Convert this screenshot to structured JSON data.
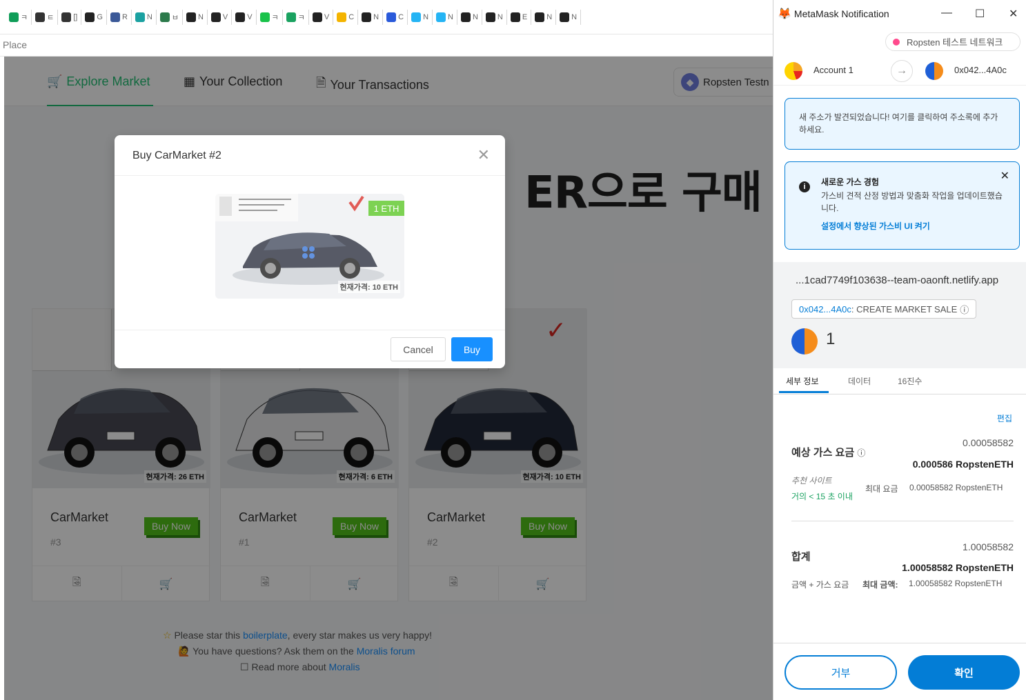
{
  "browser": {
    "tabs": [
      {
        "icon": "spreadsheet-icon",
        "label": "ㅋ",
        "color": "#0f9d58"
      },
      {
        "icon": "notion-icon",
        "label": "ㅌ",
        "color": "#333333"
      },
      {
        "icon": "notion-icon",
        "label": "[]",
        "color": "#333333"
      },
      {
        "icon": "github-icon",
        "label": "G",
        "color": "#222222"
      },
      {
        "icon": "flag-icon",
        "label": "R",
        "color": "#3b5998"
      },
      {
        "icon": "diamond-icon",
        "label": "N",
        "color": "#1ba1a1"
      },
      {
        "icon": "grid-icon",
        "label": "ㅂ",
        "color": "#2c7a4b"
      },
      {
        "icon": "github-icon",
        "label": "N",
        "color": "#222222"
      },
      {
        "icon": "github-icon",
        "label": "V",
        "color": "#222222"
      },
      {
        "icon": "github-icon",
        "label": "V",
        "color": "#222222"
      },
      {
        "icon": "n-icon",
        "label": "ㅋ",
        "color": "#19c24a"
      },
      {
        "icon": "chat-icon",
        "label": "ㅋ",
        "color": "#1aa260"
      },
      {
        "icon": "github-icon",
        "label": "V",
        "color": "#222222"
      },
      {
        "icon": "drive-icon",
        "label": "C",
        "color": "#f4b400"
      },
      {
        "icon": "github-icon",
        "label": "N",
        "color": "#222222"
      },
      {
        "icon": "moralis-icon",
        "label": "C",
        "color": "#2a5ada"
      },
      {
        "icon": "moralis-icon",
        "label": "N",
        "color": "#25b4f4"
      },
      {
        "icon": "moralis-icon",
        "label": "N",
        "color": "#25b4f4"
      },
      {
        "icon": "m-icon",
        "label": "N",
        "color": "#222222"
      },
      {
        "icon": "m-icon",
        "label": "N",
        "color": "#222222"
      },
      {
        "icon": "m-icon",
        "label": "E",
        "color": "#222222"
      },
      {
        "icon": "m-icon",
        "label": "N",
        "color": "#222222"
      },
      {
        "icon": "m-icon",
        "label": "N",
        "color": "#222222"
      }
    ],
    "address_fragment": "Place"
  },
  "nav": {
    "explore": "Explore Market",
    "collection": "Your Collection",
    "transactions": "Your Transactions",
    "network": "Ropsten Testn"
  },
  "cards": [
    {
      "title": "CarMarket",
      "number": "#3",
      "buy": "Buy Now",
      "price_tag": "현재가격: 26 ETH",
      "car_color": "#4a4a55"
    },
    {
      "title": "CarMarket",
      "number": "#1",
      "buy": "Buy Now",
      "price_tag": "현재가격: 6 ETH",
      "car_color": "#e8e8ea"
    },
    {
      "title": "CarMarket",
      "number": "#2",
      "buy": "Buy Now",
      "price_tag": "현재가격: 10 ETH",
      "car_color": "#22283a"
    }
  ],
  "footer": {
    "line1_pre": "Please star this ",
    "line1_link": "boilerplate",
    "line1_post": ", every star makes us very happy!",
    "line2_pre": "You have questions? Ask them on the ",
    "line2_link": "Moralis forum",
    "line3_pre": "Read more about ",
    "line3_link": "Moralis"
  },
  "modal": {
    "title": "Buy CarMarket #2",
    "price": "1 ETH",
    "price_tag": "현재가격: 10 ETH",
    "cancel": "Cancel",
    "buy": "Buy"
  },
  "caption": "ER으로 구매",
  "metamask": {
    "window_title": "MetaMask Notification",
    "network": "Ropsten 테스트 네트워크",
    "from_account": "Account 1",
    "to_address": "0x042...4A0c",
    "new_address_notice": "새 주소가 발견되었습니다! 여기를 클릭하여 주소록에 추가하세요.",
    "gas_notice_title": "새로운 가스 경험",
    "gas_notice_body": "가스비 견적 산정 방법과 맞춤화 작업을 업데이트했습니다.",
    "gas_notice_link": "설정에서 향상된 가스비 UI 켜기",
    "origin": "...1cad7749f103638--team-oaonft.netlify.app",
    "method_address": "0x042...4A0c",
    "method_name": " : CREATE MARKET SALE",
    "amount": "1",
    "tabs": {
      "details": "세부 정보",
      "data": "데이터",
      "hex": "16진수"
    },
    "edit": "편집",
    "gas_label": "예상 가스 요금",
    "gas_value_small": "0.00058582",
    "gas_value_bold": "0.000586 RopstenETH",
    "site_suggested": "추천 사이트",
    "time_estimate": "거의 < 15 초 이내",
    "max_fee_label": "최대 요금",
    "max_fee_value": "0.00058582 RopstenETH",
    "total_label": "합계",
    "total_small": "1.00058582",
    "total_bold": "1.00058582 RopstenETH",
    "total_sub_label": "금액 + 가스 요금",
    "max_amount_label": "최대 금액:",
    "max_amount_value": "1.00058582 RopstenETH",
    "reject": "거부",
    "confirm": "확인"
  }
}
